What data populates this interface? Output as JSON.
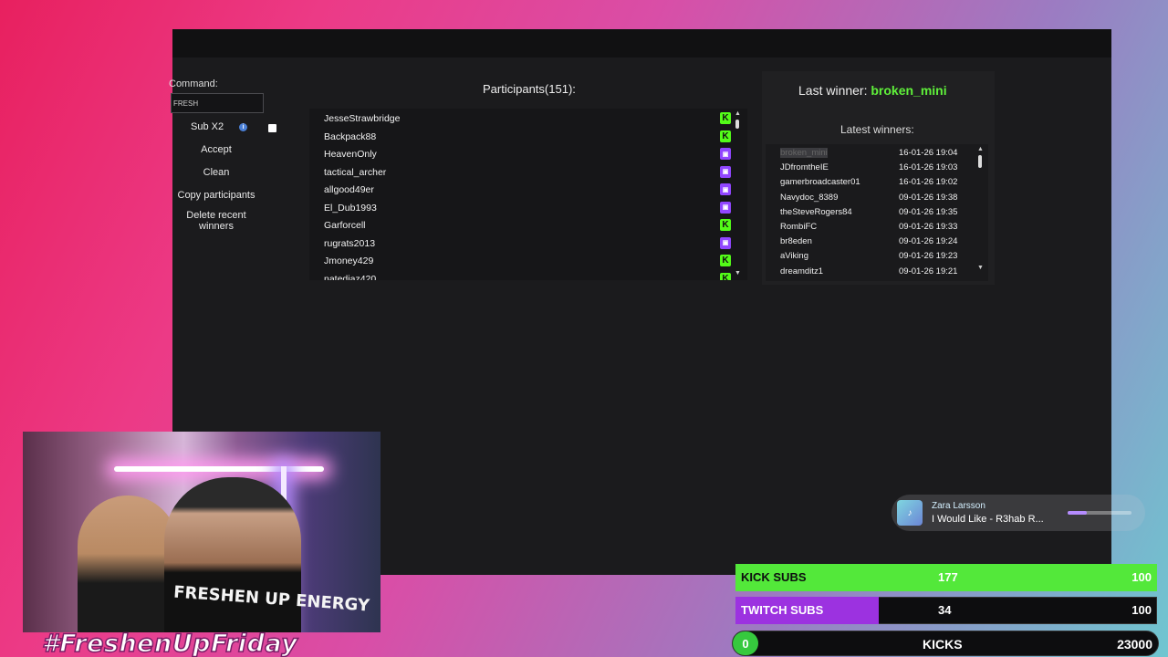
{
  "controls": {
    "command_label": "Command:",
    "command_value": "FRESH",
    "sub_label": "Sub X2",
    "buttons": [
      "Accept",
      "Clean",
      "Copy participants",
      "Delete recent winners"
    ]
  },
  "participants": {
    "title": "Participants(151):",
    "rows": [
      {
        "name": "JesseStrawbridge",
        "platform": "kick"
      },
      {
        "name": "Backpack88",
        "platform": "kick"
      },
      {
        "name": "HeavenOnly",
        "platform": "twitch"
      },
      {
        "name": "tactical_archer",
        "platform": "twitch"
      },
      {
        "name": "allgood49er",
        "platform": "twitch"
      },
      {
        "name": "El_Dub1993",
        "platform": "twitch"
      },
      {
        "name": "Garforcell",
        "platform": "kick"
      },
      {
        "name": "rugrats2013",
        "platform": "twitch"
      },
      {
        "name": "Jmoney429",
        "platform": "kick"
      },
      {
        "name": "natediaz420",
        "platform": "kick"
      }
    ]
  },
  "winners": {
    "last_winner_label": "Last winner:",
    "last_winner_name": "broken_mini",
    "latest_label": "Latest winners:",
    "rows": [
      {
        "name": "broken_mini",
        "date": "16-01-26 19:04"
      },
      {
        "name": "JDfromtheIE",
        "date": "16-01-26 19:03"
      },
      {
        "name": "gamerbroadcaster01",
        "date": "16-01-26 19:02"
      },
      {
        "name": "Navydoc_8389",
        "date": "09-01-26 19:38"
      },
      {
        "name": "theSteveRogers84",
        "date": "09-01-26 19:35"
      },
      {
        "name": "RombiFC",
        "date": "09-01-26 19:33"
      },
      {
        "name": "br8eden",
        "date": "09-01-26 19:24"
      },
      {
        "name": "aViking",
        "date": "09-01-26 19:23"
      },
      {
        "name": "dreamditz1",
        "date": "09-01-26 19:21"
      }
    ]
  },
  "overlay": {
    "hashtag": "#FreshenUpFriday",
    "shirt_text": "FRESHEN UP ENERGY",
    "now_playing": {
      "artist": "Zara Larsson",
      "title": "I Would Like - R3hab R...",
      "progress": 0.3
    },
    "goals": [
      {
        "label": "KICK SUBS",
        "count": "177",
        "target": "100",
        "fill": 1.0,
        "color": "#53e83a"
      },
      {
        "label": "TWITCH SUBS",
        "count": "34",
        "target": "100",
        "fill": 0.34,
        "color": "#9c32e0"
      }
    ],
    "kicks": {
      "count": "0",
      "label": "KICKS",
      "target": "23000"
    }
  }
}
